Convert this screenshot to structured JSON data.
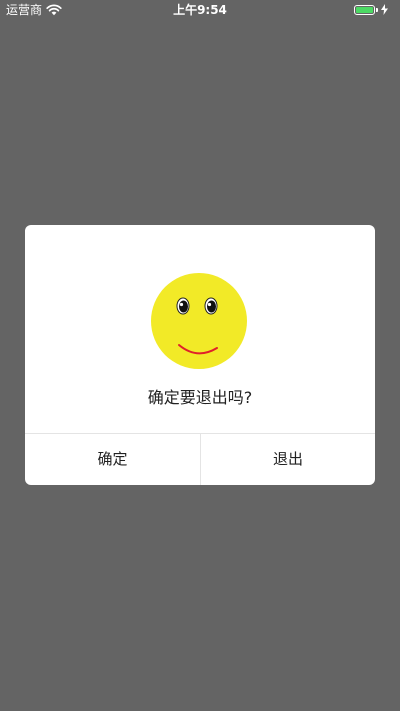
{
  "status_bar": {
    "carrier": "运营商",
    "time": "上午9:54",
    "wifi_icon": "wifi-icon",
    "battery_icon": "battery-icon",
    "battery_level": 1.0,
    "battery_color": "#4cd964"
  },
  "dialog": {
    "image_icon": "smiley-face-icon",
    "face_color": "#f2ea27",
    "smile_color": "#e0202a",
    "message": "确定要退出吗?",
    "confirm_label": "确定",
    "exit_label": "退出"
  },
  "overlay_color": "#646464"
}
